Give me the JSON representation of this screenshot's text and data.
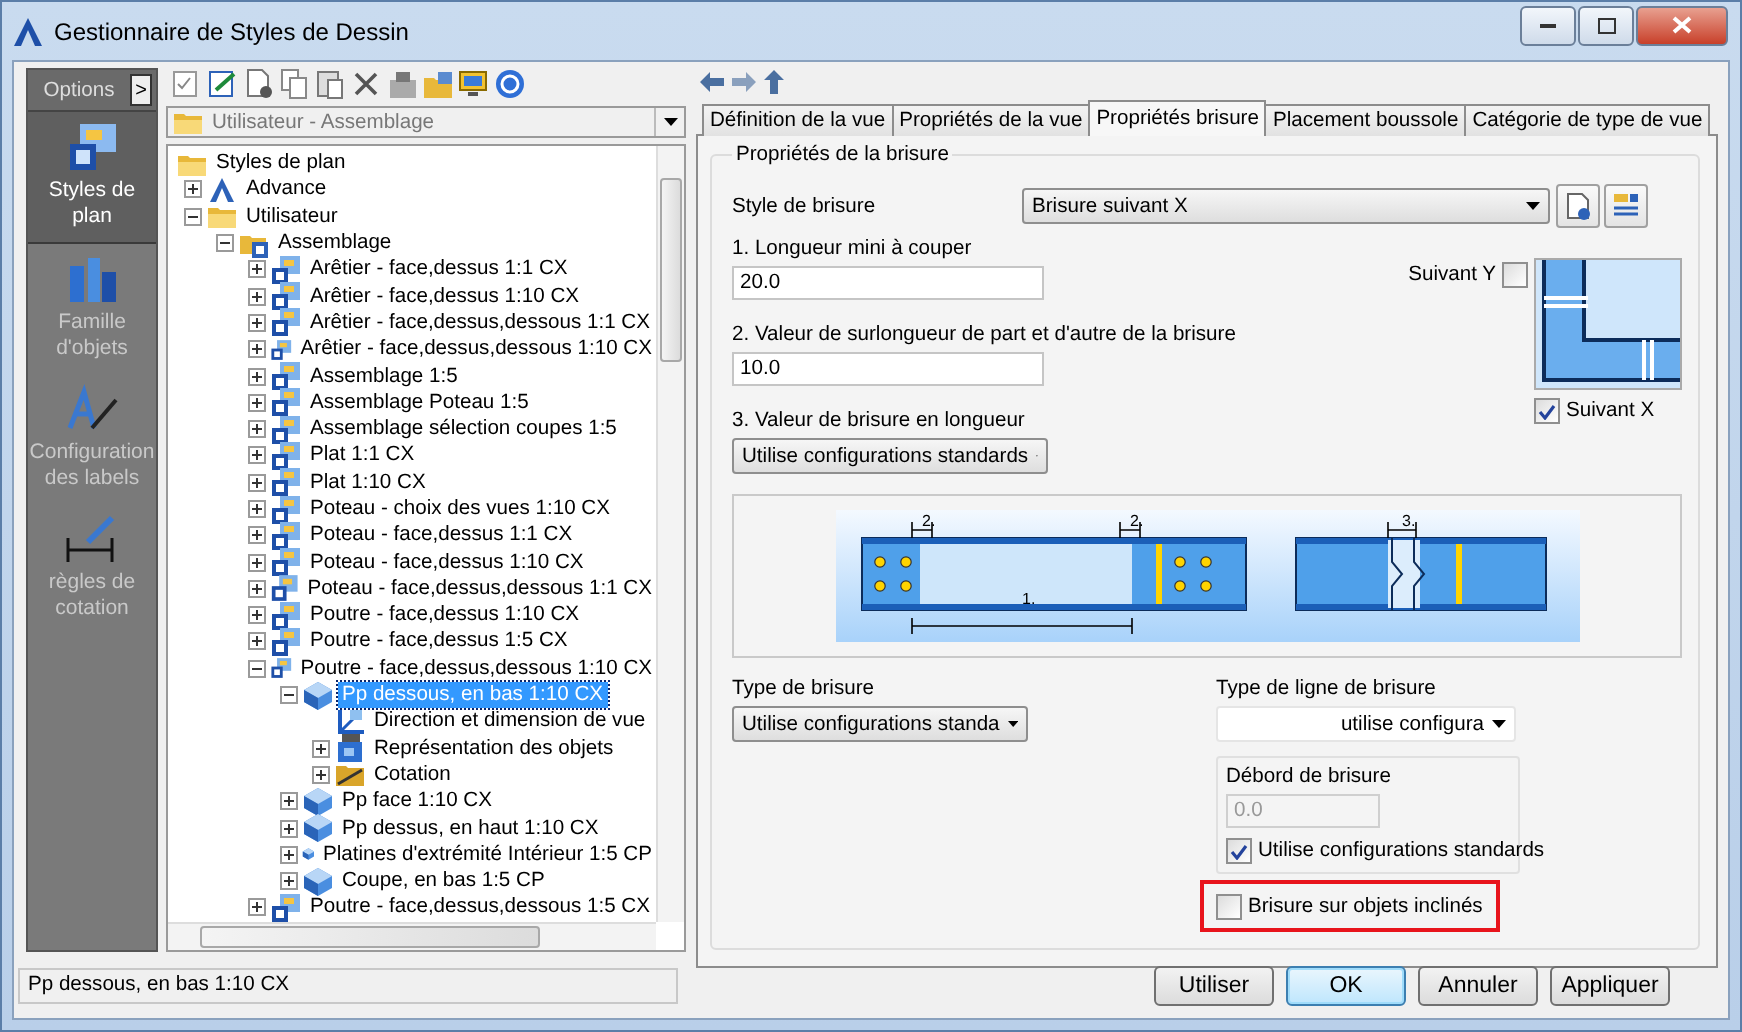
{
  "window": {
    "title": "Gestionnaire de Styles de Dessin"
  },
  "sidebar": {
    "options_label": "Options",
    "toggle": ">",
    "items": [
      {
        "label": "Styles de plan",
        "kind": "plan",
        "selected": true
      },
      {
        "label": "Famille d'objets",
        "kind": "family",
        "selected": false
      },
      {
        "label": "Configuration des labels",
        "kind": "labels",
        "selected": false
      },
      {
        "label": "règles de cotation",
        "kind": "dimension",
        "selected": false
      }
    ]
  },
  "tree_panel": {
    "location": "Utilisateur - Assemblage",
    "tree": {
      "label": "Styles de plan",
      "kind": "folder",
      "selected": false,
      "children": [
        {
          "label": "Advance",
          "kind": "brand",
          "expanded": false,
          "selected": false
        },
        {
          "label": "Utilisateur",
          "kind": "folder",
          "expanded": true,
          "selected": false,
          "children": [
            {
              "label": "Assemblage",
              "kind": "group",
              "expanded": true,
              "selected": false,
              "children": [
                {
                  "label": "Arêtier - face,dessus 1:1 CX",
                  "kind": "style",
                  "expanded": false,
                  "selected": false
                },
                {
                  "label": "Arêtier - face,dessus 1:10 CX",
                  "kind": "style",
                  "expanded": false,
                  "selected": false
                },
                {
                  "label": "Arêtier - face,dessus,dessous 1:1 CX",
                  "kind": "style",
                  "expanded": false,
                  "selected": false
                },
                {
                  "label": "Arêtier - face,dessus,dessous 1:10 CX",
                  "kind": "style",
                  "expanded": false,
                  "selected": false
                },
                {
                  "label": "Assemblage 1:5",
                  "kind": "style",
                  "expanded": false,
                  "selected": false
                },
                {
                  "label": "Assemblage Poteau 1:5",
                  "kind": "style",
                  "expanded": false,
                  "selected": false
                },
                {
                  "label": "Assemblage sélection coupes 1:5",
                  "kind": "style",
                  "expanded": false,
                  "selected": false
                },
                {
                  "label": "Plat 1:1 CX",
                  "kind": "style",
                  "expanded": false,
                  "selected": false
                },
                {
                  "label": "Plat 1:10 CX",
                  "kind": "style",
                  "expanded": false,
                  "selected": false
                },
                {
                  "label": "Poteau - choix des vues 1:10 CX",
                  "kind": "style",
                  "expanded": false,
                  "selected": false
                },
                {
                  "label": "Poteau - face,dessus 1:1 CX",
                  "kind": "style",
                  "expanded": false,
                  "selected": false
                },
                {
                  "label": "Poteau - face,dessus 1:10 CX",
                  "kind": "style",
                  "expanded": false,
                  "selected": false
                },
                {
                  "label": "Poteau - face,dessus,dessous 1:1 CX",
                  "kind": "style",
                  "expanded": false,
                  "selected": false
                },
                {
                  "label": "Poutre - face,dessus 1:10 CX",
                  "kind": "style",
                  "expanded": false,
                  "selected": false
                },
                {
                  "label": "Poutre - face,dessus 1:5 CX",
                  "kind": "style",
                  "expanded": false,
                  "selected": false
                },
                {
                  "label": "Poutre - face,dessus,dessous 1:10 CX",
                  "kind": "style",
                  "expanded": true,
                  "selected": false,
                  "children": [
                    {
                      "label": "Pp dessous, en bas 1:10 CX",
                      "kind": "view",
                      "expanded": true,
                      "selected": true,
                      "children": [
                        {
                          "label": "Direction et dimension de vue",
                          "kind": "direction",
                          "selected": false
                        },
                        {
                          "label": "Représentation des objets",
                          "kind": "objects",
                          "expanded": false,
                          "selected": false
                        },
                        {
                          "label": "Cotation",
                          "kind": "dimension",
                          "expanded": false,
                          "selected": false
                        }
                      ]
                    },
                    {
                      "label": "Pp face 1:10 CX",
                      "kind": "view",
                      "expanded": false,
                      "selected": false
                    },
                    {
                      "label": "Pp dessus, en haut 1:10 CX",
                      "kind": "view",
                      "expanded": false,
                      "selected": false
                    },
                    {
                      "label": "Platines d'extrémité Intérieur 1:5 CP",
                      "kind": "view",
                      "expanded": false,
                      "selected": false
                    },
                    {
                      "label": "Coupe, en bas 1:5 CP",
                      "kind": "view",
                      "expanded": false,
                      "selected": false
                    }
                  ]
                },
                {
                  "label": "Poutre - face,dessus,dessous 1:5 CX",
                  "kind": "style",
                  "expanded": false,
                  "selected": false
                }
              ]
            }
          ]
        }
      ]
    }
  },
  "tabs": [
    {
      "label": "Définition de la vue",
      "selected": false
    },
    {
      "label": "Propriétés de la vue",
      "selected": false
    },
    {
      "label": "Propriétés brisure",
      "selected": true
    },
    {
      "label": "Placement boussole",
      "selected": false
    },
    {
      "label": "Catégorie de type de vue",
      "selected": false
    }
  ],
  "break_properties": {
    "title": "Propriétés de la brisure",
    "style_label": "Style de brisure",
    "style_value": "Brisure suivant X",
    "min_length_label": "1. Longueur mini à couper",
    "min_length_value": "20.0",
    "overlength_label": "2. Valeur de surlongueur de part et d'autre de la brisure",
    "overlength_value": "10.0",
    "break_length_label": "3. Valeur de brisure en longueur",
    "break_length_value": "Utilise configurations standards",
    "follow_y": {
      "label": "Suivant Y",
      "checked": false
    },
    "follow_x": {
      "label": "Suivant X",
      "checked": true
    },
    "diagram_labels": [
      "2.",
      "2.",
      "1.",
      "3."
    ],
    "break_type_label": "Type de brisure",
    "break_type_value": "Utilise configurations standa",
    "line_type_label": "Type de ligne de brisure",
    "line_type_value": "utilise configura",
    "overhang": {
      "label": "Débord de brisure",
      "value": "0.0",
      "disabled": true,
      "use_standard": {
        "label": "Utilise configurations standards",
        "checked": true
      }
    },
    "inclined": {
      "label": "Brisure sur objets inclinés",
      "checked": false,
      "highlighted": true
    }
  },
  "status_bar": {
    "text": "Pp dessous, en bas 1:10 CX"
  },
  "buttons": [
    {
      "label": "Utiliser",
      "default": false
    },
    {
      "label": "OK",
      "default": true
    },
    {
      "label": "Annuler",
      "default": false
    },
    {
      "label": "Appliquer",
      "default": false
    }
  ]
}
